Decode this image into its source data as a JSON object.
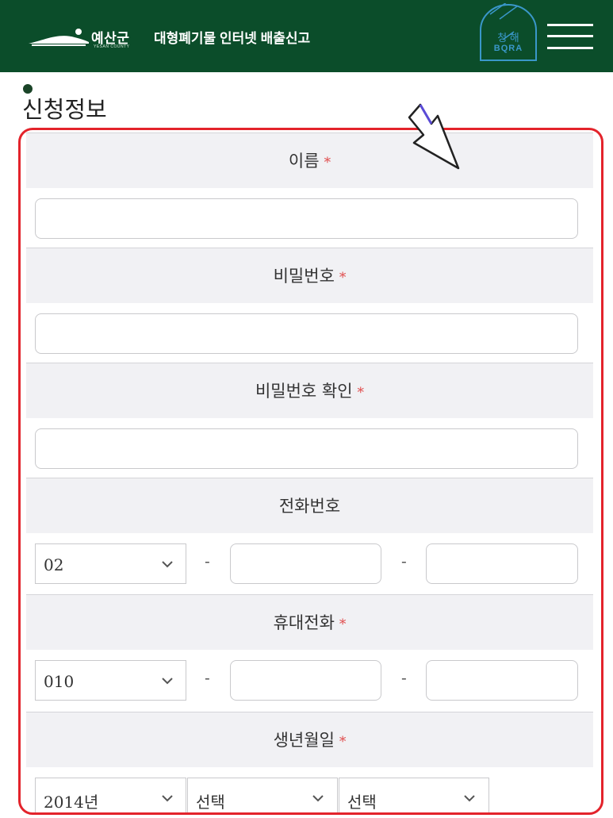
{
  "header": {
    "brand_kor": "예산군",
    "brand_en": "YESAN COUNTY",
    "service_title": "대형폐기물 인터넷 배출신고",
    "badge_top": "청 해",
    "badge_bottom": "BQRA",
    "menu_icon": "hamburger-menu-icon",
    "background_color": "#0b4d2a"
  },
  "section": {
    "title": "신청정보"
  },
  "form": {
    "required_mark": "*",
    "name_label": "이름",
    "password_label": "비밀번호",
    "password_confirm_label": "비밀번호 확인",
    "phone_label": "전화번호",
    "phone_prefix": "02",
    "mobile_label": "휴대전화",
    "mobile_prefix": "010",
    "separator": "-",
    "birth_label": "생년월일",
    "birth_year": "2014년",
    "birth_month": "선택",
    "birth_day": "선택"
  },
  "annotation": {
    "highlight_color": "#e3232b",
    "arrow_color": "#5a4bd6"
  }
}
